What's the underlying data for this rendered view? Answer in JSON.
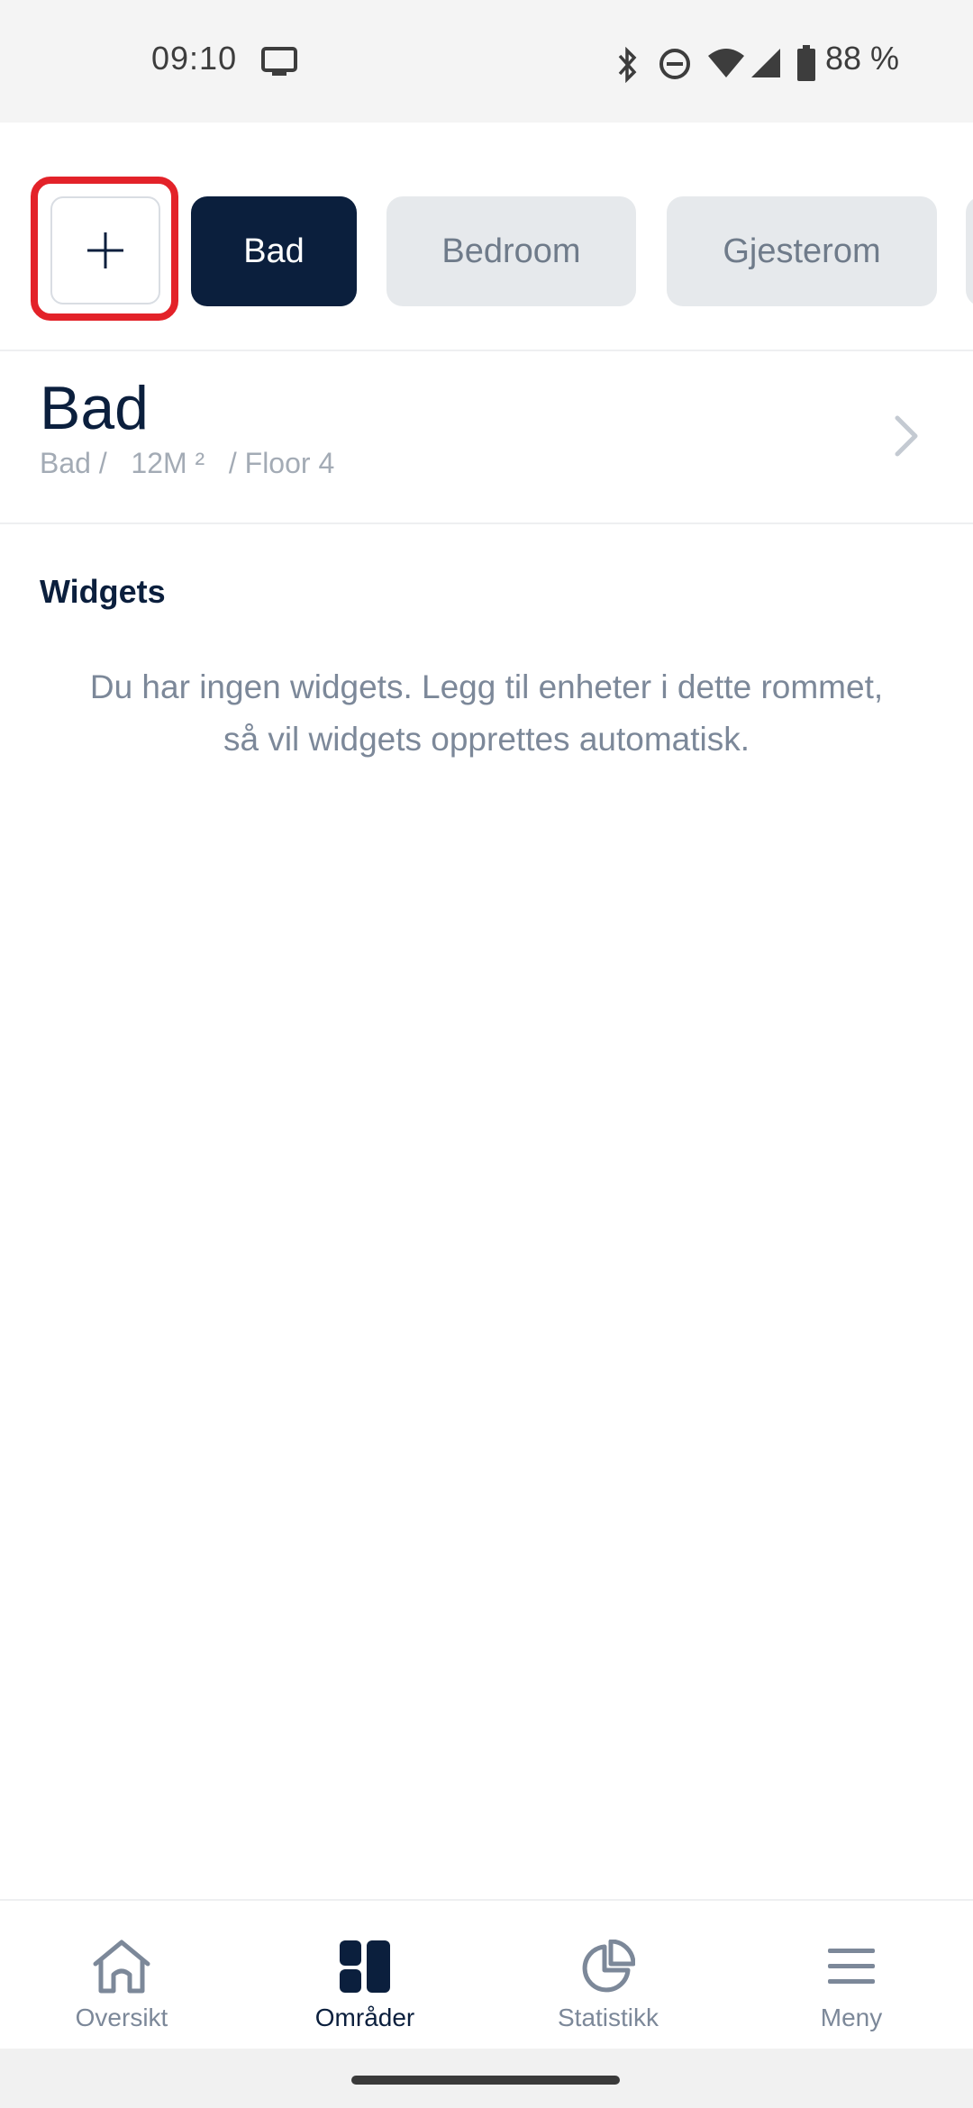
{
  "status_bar": {
    "time": "09:10",
    "battery": "88 %",
    "icons": [
      "cast-icon",
      "bluetooth-icon",
      "do-not-disturb-icon",
      "wifi-icon",
      "signal-icon",
      "battery-icon"
    ]
  },
  "tabs": {
    "add_icon": "plus-icon",
    "items": [
      {
        "label": "Bad",
        "active": true
      },
      {
        "label": "Bedroom",
        "active": false
      },
      {
        "label": "Gjesterom",
        "active": false
      }
    ]
  },
  "room": {
    "title": "Bad",
    "meta_type": "Bad /",
    "meta_size": "12M ²",
    "meta_floor": "/ Floor 4"
  },
  "widgets": {
    "title": "Widgets",
    "empty_text": "Du har ingen widgets. Legg til enheter i dette rommet, så vil widgets opprettes automatisk."
  },
  "bottom_nav": {
    "items": [
      {
        "label": "Oversikt",
        "icon": "home-icon",
        "active": false
      },
      {
        "label": "Områder",
        "icon": "areas-grid-icon",
        "active": true
      },
      {
        "label": "Statistikk",
        "icon": "pie-chart-icon",
        "active": false
      },
      {
        "label": "Meny",
        "icon": "menu-icon",
        "active": false
      }
    ]
  },
  "colors": {
    "primary": "#0b1f3d",
    "inactive_tab_bg": "#e6e9ec",
    "muted_text": "#7c8899",
    "highlight": "#e32229"
  }
}
